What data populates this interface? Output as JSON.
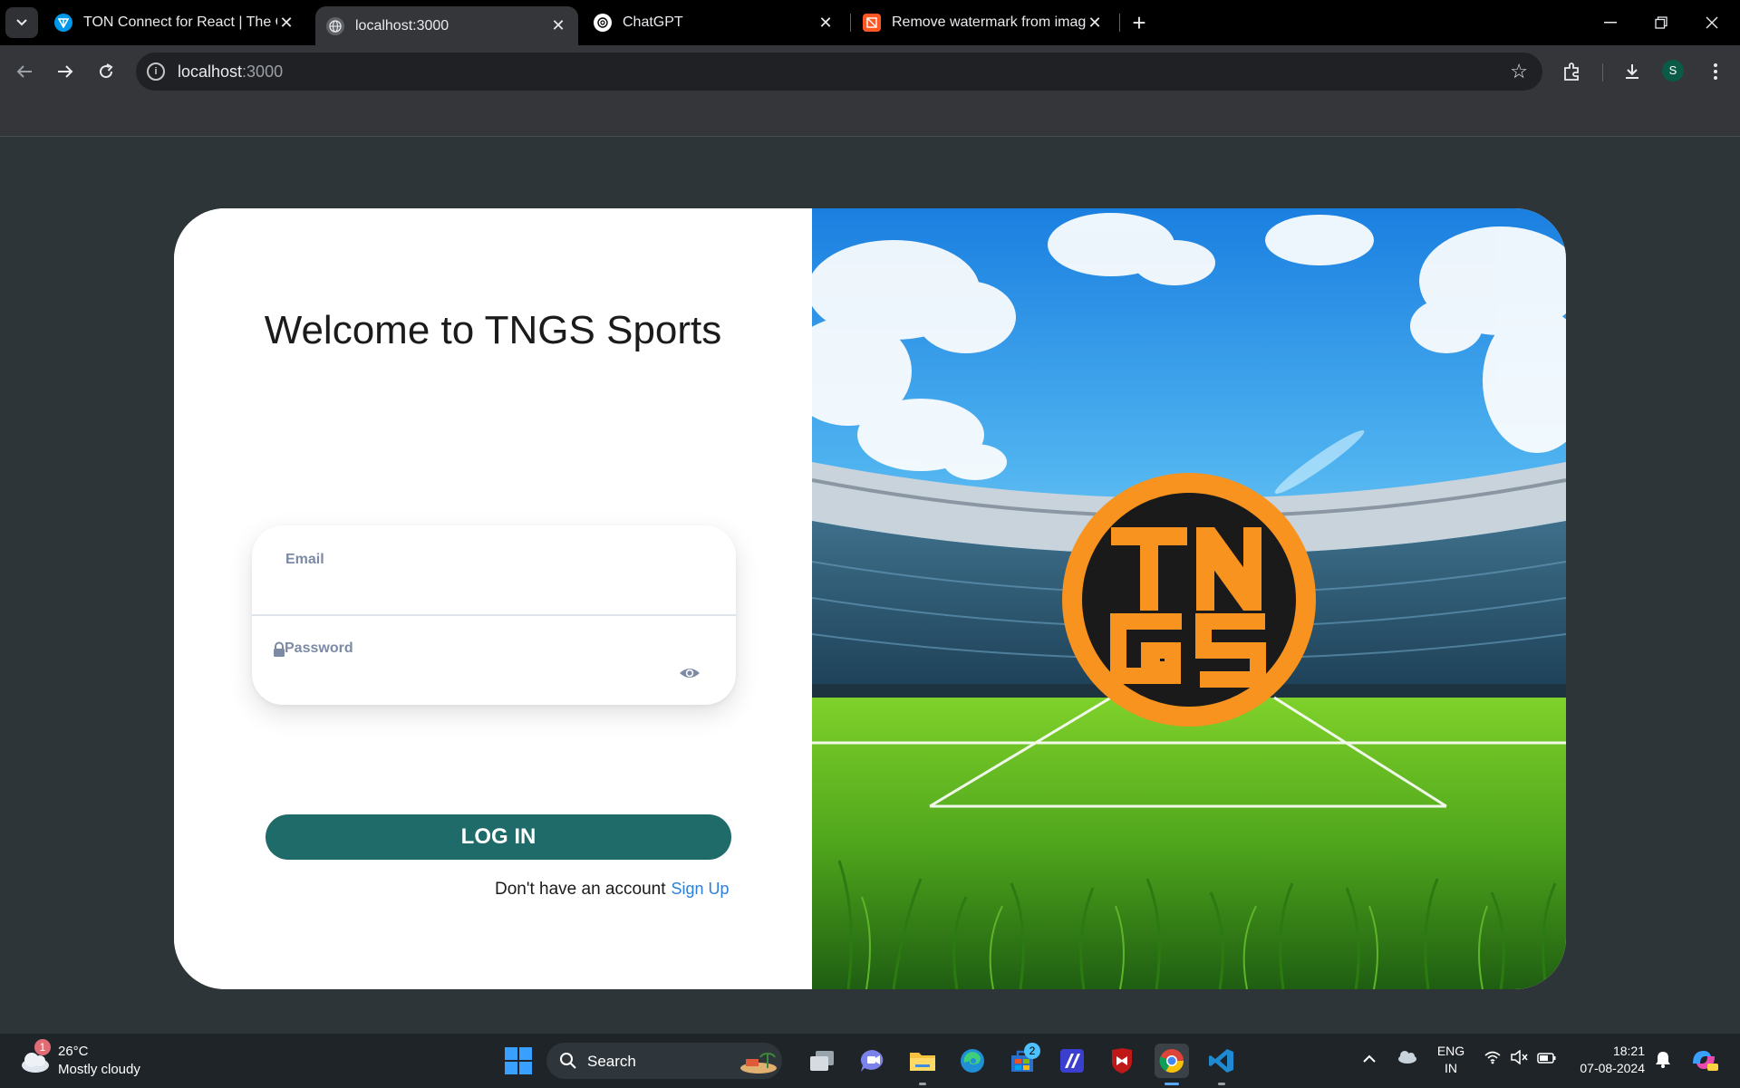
{
  "browser": {
    "tabs": [
      {
        "title": "TON Connect for React | The Op",
        "active": false
      },
      {
        "title": "localhost:3000",
        "active": true
      },
      {
        "title": "ChatGPT",
        "active": false
      },
      {
        "title": "Remove watermark from image",
        "active": false
      }
    ],
    "url_host": "localhost",
    "url_port": ":3000",
    "profile_initial": "S"
  },
  "login": {
    "welcome": "Welcome to TNGS Sports",
    "email_label": "Email",
    "password_label": "Password",
    "login_button": "LOG IN",
    "signup_prompt": "Don't have an account",
    "signup_link": "Sign Up",
    "logo_letters": "TNGS",
    "colors": {
      "button": "#1f6b6a",
      "link": "#2f7fd6",
      "logo_orange": "#f7931e"
    }
  },
  "taskbar": {
    "weather_badge": "1",
    "temperature": "26°C",
    "weather_desc": "Mostly cloudy",
    "search_label": "Search",
    "store_badge": "2",
    "lang_line1": "ENG",
    "lang_line2": "IN",
    "time": "18:21",
    "date": "07-08-2024"
  }
}
